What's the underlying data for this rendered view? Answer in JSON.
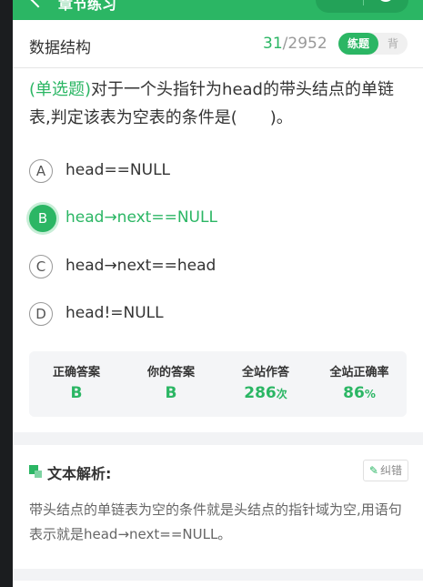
{
  "nav": {
    "title": "章节练习"
  },
  "header": {
    "subject": "数据结构",
    "current": "31",
    "separator": "/",
    "total": "2952",
    "mode_practice": "练题",
    "mode_recite": "背"
  },
  "question": {
    "type": "(单选题)",
    "text": "对于一个头指针为head的带头结点的单链表,判定该表为空表的条件是(　　)。",
    "options": [
      {
        "letter": "A",
        "text": "head==NULL"
      },
      {
        "letter": "B",
        "text": "head→next==NULL"
      },
      {
        "letter": "C",
        "text": "head→next==head"
      },
      {
        "letter": "D",
        "text": "head!=NULL"
      }
    ],
    "selected": "B"
  },
  "stats": [
    {
      "label": "正确答案",
      "value": "B",
      "unit": ""
    },
    {
      "label": "你的答案",
      "value": "B",
      "unit": ""
    },
    {
      "label": "全站作答",
      "value": "286",
      "unit": "次"
    },
    {
      "label": "全站正确率",
      "value": "86",
      "unit": "%"
    }
  ],
  "analysis": {
    "title": "文本解析:",
    "report_label": "纠错",
    "text": "带头结点的单链表为空的条件就是头结点的指针域为空,用语句表示就是head→next==NULL。"
  },
  "colors": {
    "accent": "#2bb664",
    "background": "#f2f3f5"
  },
  "icons": [
    "back-arrow-icon",
    "timer-icon",
    "section-icon",
    "edit-icon"
  ]
}
